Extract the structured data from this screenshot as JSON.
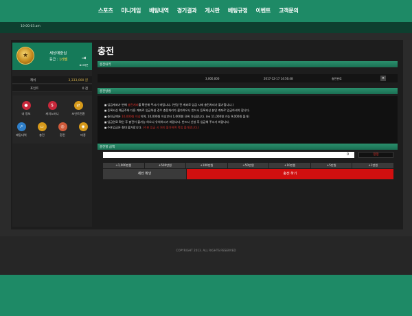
{
  "nav": {
    "items": [
      "스포츠",
      "미니게임",
      "베팅내역",
      "경기결과",
      "게시판",
      "베팅규정",
      "이벤트",
      "고객문의"
    ]
  },
  "ticker": {
    "text": "10:00:03.am"
  },
  "profile": {
    "username": "세상에중심",
    "grade_label": "등급 :",
    "grade_value": "1레벨",
    "logout_label": "로그아웃",
    "cash_label": "캐쉬",
    "cash_value": "3,333,000 원",
    "points_label": "포인트",
    "points_value": "0 점"
  },
  "shortcuts": [
    {
      "label": "내 정보",
      "icon": "user-icon",
      "color": "#c8283b"
    },
    {
      "label": "캐치노머니",
      "icon": "money-bag-icon",
      "color": "#c8283b"
    },
    {
      "label": "포인트전환",
      "icon": "exchange-icon",
      "color": "#d79a1a"
    },
    {
      "label": "베팅내역",
      "icon": "chart-icon",
      "color": "#2f7fc9"
    },
    {
      "label": "충전",
      "icon": "charge-icon",
      "color": "#d79a1a"
    },
    {
      "label": "환전",
      "icon": "withdraw-icon",
      "color": "#d05a3a"
    },
    {
      "label": "머퐁",
      "icon": "coin-icon",
      "color": "#d79a1a"
    }
  ],
  "page": {
    "title": "충전",
    "history_bar": "충전내역",
    "history": {
      "amount": "3,000,000",
      "date": "2017-12-17 14:56:48",
      "status": "충전완료"
    },
    "notice_bar": "충전방법",
    "notices": [
      {
        "a": "입금계좌가 변해 ",
        "r": "충전계좌",
        "b": "를 확인해 주시기 바랍니다. (변경 전 계좌로 입금 시에 충전처리가 불가합니다.)"
      },
      {
        "a": "등록되신 예금주와 다른 계좌로 입금하실 경우 충전처리가 불가하오니 반드시 등록되신 본인 계좌로 입금하셔야 합니다.",
        "r": "",
        "b": ""
      },
      {
        "a": "충전금액은 ",
        "r": "10,000원 이상",
        "b": "이며, 10,000원 이상부터 1,000원 단위 가능합니다. (ex 11,000원 가능 9,000원 불가)"
      },
      {
        "a": "입금완료 확인 후 충전이 불가능 하오니 유의하시기 바랍니다. 반드시 신청 후 입금해 주시기 바랍니다.",
        "r": "",
        "b": ""
      },
      {
        "a": "수표입금은 절대 불가합니다. ",
        "r": "(수표 입금 시 처리 불가하며 적립 불가합니다.)",
        "b": ""
      }
    ],
    "amount_bar": "충전할 금액",
    "amount_value": "0",
    "reset_label": "정정",
    "quick_amounts": [
      "+1,000만원",
      "+500만원",
      "+100만원",
      "+50만원",
      "+10만원",
      "+5만원",
      "+1만원"
    ],
    "refresh_label": "계좌 확인",
    "submit_label": "충전 하기"
  },
  "footer": {
    "copyright": "COPYRIGHT 2013. ALL RIGHTS RESERVED"
  }
}
